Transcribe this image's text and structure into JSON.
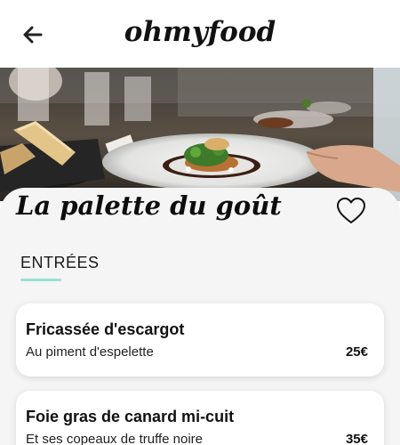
{
  "header": {
    "logo": "ohmyfood",
    "back_icon": "arrow-left-icon"
  },
  "hero": {
    "image": "restaurant table with plated food photo"
  },
  "restaurant": {
    "name": "La palette du goût",
    "like_icon": "heart-outline-icon"
  },
  "menu": {
    "section_title": "ENTRÉES",
    "accent_color": "#99e2d0",
    "items": [
      {
        "name": "Fricassée d'escargot",
        "description": "Au piment d'espelette",
        "price": "25€"
      },
      {
        "name": "Foie gras de canard mi-cuit",
        "description": "Et ses copeaux de truffe noire",
        "price": "35€"
      }
    ]
  }
}
